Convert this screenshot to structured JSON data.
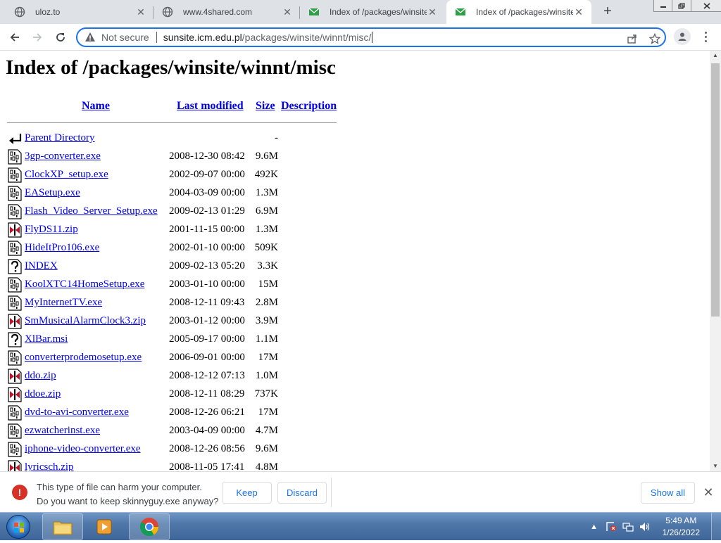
{
  "browser": {
    "tabs": [
      {
        "title": "uloz.to",
        "icon": "globe-icon",
        "active": false
      },
      {
        "title": "www.4shared.com",
        "icon": "globe-icon",
        "active": false
      },
      {
        "title": "Index of /packages/winsite/",
        "icon": "sunsite-icon",
        "active": false
      },
      {
        "title": "Index of /packages/winsite/",
        "icon": "sunsite-icon",
        "active": true
      }
    ],
    "new_tab": "+",
    "omnibox": {
      "security": "Not secure",
      "url_host": "sunsite.icm.edu.pl",
      "url_path": "/packages/winsite/winnt/misc/"
    }
  },
  "page": {
    "title": "Index of /packages/winsite/winnt/misc",
    "columns": {
      "name": "Name",
      "last_modified": "Last modified",
      "size": "Size",
      "description": "Description"
    },
    "rows": [
      {
        "name": "Parent Directory",
        "date": "",
        "size": "-",
        "icon": "back-icon"
      },
      {
        "name": "3gp-converter.exe",
        "date": "2008-12-30 08:42",
        "size": "9.6M",
        "icon": "binary-icon"
      },
      {
        "name": "ClockXP_setup.exe",
        "date": "2002-09-07 00:00",
        "size": "492K",
        "icon": "binary-icon"
      },
      {
        "name": "EASetup.exe",
        "date": "2004-03-09 00:00",
        "size": "1.3M",
        "icon": "binary-icon"
      },
      {
        "name": "Flash_Video_Server_Setup.exe",
        "date": "2009-02-13 01:29",
        "size": "6.9M",
        "icon": "binary-icon"
      },
      {
        "name": "FlyDS11.zip",
        "date": "2001-11-15 00:00",
        "size": "1.3M",
        "icon": "compressed-icon"
      },
      {
        "name": "HideItPro106.exe",
        "date": "2002-01-10 00:00",
        "size": "509K",
        "icon": "binary-icon"
      },
      {
        "name": "INDEX",
        "date": "2009-02-13 05:20",
        "size": "3.3K",
        "icon": "unknown-icon"
      },
      {
        "name": "KoolXTC14HomeSetup.exe",
        "date": "2003-01-10 00:00",
        "size": "15M",
        "icon": "binary-icon"
      },
      {
        "name": "MyInternetTV.exe",
        "date": "2008-12-11 09:43",
        "size": "2.8M",
        "icon": "binary-icon"
      },
      {
        "name": "SmMusicalAlarmClock3.zip",
        "date": "2003-01-12 00:00",
        "size": "3.9M",
        "icon": "compressed-icon"
      },
      {
        "name": "XlBar.msi",
        "date": "2005-09-17 00:00",
        "size": "1.1M",
        "icon": "unknown-icon"
      },
      {
        "name": "converterprodemosetup.exe",
        "date": "2006-09-01 00:00",
        "size": "17M",
        "icon": "binary-icon"
      },
      {
        "name": "ddo.zip",
        "date": "2008-12-12 07:13",
        "size": "1.0M",
        "icon": "compressed-icon"
      },
      {
        "name": "ddoe.zip",
        "date": "2008-12-11 08:29",
        "size": "737K",
        "icon": "compressed-icon"
      },
      {
        "name": "dvd-to-avi-converter.exe",
        "date": "2008-12-26 06:21",
        "size": "17M",
        "icon": "binary-icon"
      },
      {
        "name": "ezwatcherinst.exe",
        "date": "2003-04-09 00:00",
        "size": "4.7M",
        "icon": "binary-icon"
      },
      {
        "name": "iphone-video-converter.exe",
        "date": "2008-12-26 08:56",
        "size": "9.6M",
        "icon": "binary-icon"
      },
      {
        "name": "lyricsch.zip",
        "date": "2008-11-05 17:41",
        "size": "4.8M",
        "icon": "compressed-icon"
      }
    ]
  },
  "download_bar": {
    "line1": "This type of file can harm your computer.",
    "line2": "Do you want to keep skinnyguy.exe anyway?",
    "keep": "Keep",
    "discard": "Discard",
    "show_all": "Show all"
  },
  "taskbar": {
    "time": "5:49 AM",
    "date": "1/26/2022"
  },
  "colors": {
    "accent": "#1a73e8",
    "link": "#0000ee",
    "error": "#d93025"
  }
}
